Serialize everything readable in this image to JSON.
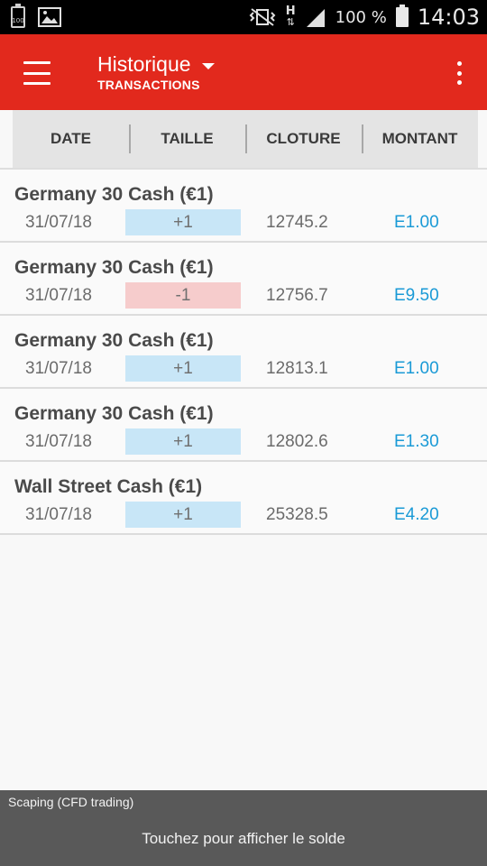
{
  "status_bar": {
    "battery_icon_text": "100",
    "battery_percent": "100 %",
    "time": "14:03",
    "network_type": "H"
  },
  "app_bar": {
    "title": "Historique",
    "subtitle": "TRANSACTIONS",
    "accent_color": "#e2291d"
  },
  "columns": [
    "DATE",
    "TAILLE",
    "CLOTURE",
    "MONTANT"
  ],
  "transactions": [
    {
      "name": "Germany 30 Cash (€1)",
      "date": "31/07/18",
      "size": "+1",
      "direction": "buy",
      "close": "12745.2",
      "amount": "E1.00"
    },
    {
      "name": "Germany 30 Cash (€1)",
      "date": "31/07/18",
      "size": "-1",
      "direction": "sell",
      "close": "12756.7",
      "amount": "E9.50"
    },
    {
      "name": "Germany 30 Cash (€1)",
      "date": "31/07/18",
      "size": "+1",
      "direction": "buy",
      "close": "12813.1",
      "amount": "E1.00"
    },
    {
      "name": "Germany 30 Cash (€1)",
      "date": "31/07/18",
      "size": "+1",
      "direction": "buy",
      "close": "12802.6",
      "amount": "E1.30"
    },
    {
      "name": "Wall Street Cash (€1)",
      "date": "31/07/18",
      "size": "+1",
      "direction": "buy",
      "close": "25328.5",
      "amount": "E4.20"
    }
  ],
  "bottom_bar": {
    "account_label": "Scaping (CFD trading)",
    "action_text": "Touchez pour afficher le solde"
  },
  "colors": {
    "buy_badge": "#c8e6f7",
    "sell_badge": "#f6cccc",
    "amount_text": "#1a9ad6"
  }
}
